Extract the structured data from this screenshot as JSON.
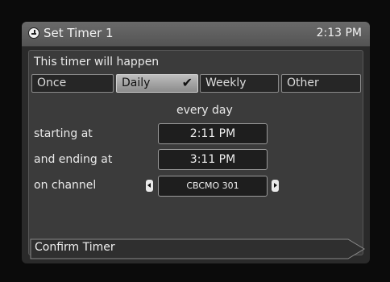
{
  "title": "Set Timer 1",
  "clock": "2:13 PM",
  "prompt": "This timer will happen",
  "frequency_tabs": [
    {
      "label": "Once",
      "selected": false
    },
    {
      "label": "Daily",
      "selected": true
    },
    {
      "label": "Weekly",
      "selected": false
    },
    {
      "label": "Other",
      "selected": false
    }
  ],
  "frequency_description": "every day",
  "start": {
    "label": "starting at",
    "value": "2:11 PM"
  },
  "end": {
    "label": "and ending at",
    "value": "3:11 PM"
  },
  "channel": {
    "label": "on channel",
    "value": "CBCMO 301"
  },
  "confirm_label": "Confirm Timer",
  "icons": {
    "title": "timer-icon",
    "selected": "checkmark-icon",
    "prev": "arrow-left-icon",
    "next": "arrow-right-icon"
  }
}
